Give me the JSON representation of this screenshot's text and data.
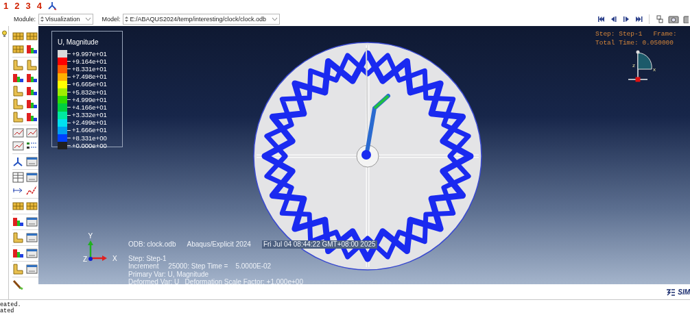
{
  "toolbar_numbers": [
    "1",
    "2",
    "3",
    "4"
  ],
  "context_bar": {
    "module_label": "Module:",
    "module_value": "Visualization",
    "model_label": "Model:",
    "model_value": "E:/ABAQUS2024/temp/interesting/clock/clock.odb"
  },
  "legend": {
    "title": "U, Magnitude",
    "entries": [
      {
        "label": "+9.997e+01",
        "color": "#d9d9d9"
      },
      {
        "label": "+9.164e+01",
        "color": "#ff0000"
      },
      {
        "label": "+8.331e+01",
        "color": "#ff5a00"
      },
      {
        "label": "+7.498e+01",
        "color": "#ffb000"
      },
      {
        "label": "+6.665e+01",
        "color": "#ffff00"
      },
      {
        "label": "+5.832e+01",
        "color": "#a0ee00"
      },
      {
        "label": "+4.999e+01",
        "color": "#30dc00"
      },
      {
        "label": "+4.166e+01",
        "color": "#00d040"
      },
      {
        "label": "+3.332e+01",
        "color": "#00e8a0"
      },
      {
        "label": "+2.499e+01",
        "color": "#00e0f0"
      },
      {
        "label": "+1.666e+01",
        "color": "#00a0f0"
      },
      {
        "label": "+8.331e+00",
        "color": "#0040ff"
      },
      {
        "label": "+0.000e+00",
        "color": "#202020"
      }
    ]
  },
  "viewport_status": {
    "step": "Step: Step-1",
    "frame": "Frame:",
    "total_time": "Total Time: 0.050000"
  },
  "view_triad_labels": {
    "x": "x",
    "z": "z"
  },
  "triad_labels": {
    "y": "Y",
    "x": "X",
    "z": "Z"
  },
  "info": {
    "odb": "ODB: clock.odb",
    "solver": "Abaqus/Explicit 2024",
    "date": "Fri Jul 04 08:44:22 GMT+08:00 2025",
    "lines": [
      "Step: Step-1",
      "Increment     25000: Step Time =    5.0000E-02",
      "Primary Var: U, Magnitude",
      "Deformed Var: U   Deformation Scale Factor: +1.000e+00"
    ]
  },
  "brand": "SIM",
  "messages": [
    "eated.",
    "ated"
  ]
}
